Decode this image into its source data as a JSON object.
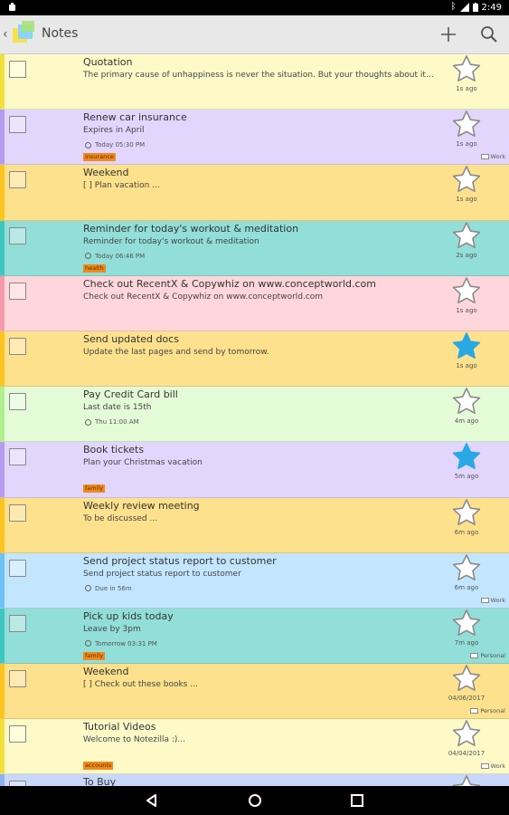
{
  "status_bar": {
    "time": "2:49"
  },
  "app_bar": {
    "title": "Notes"
  },
  "icons": {
    "back": "chevron-left-icon",
    "logo": "sticky-notes-logo-icon",
    "add": "plus-icon",
    "search": "search-icon"
  },
  "colors": {
    "yellow": "#fdfac8",
    "purple": "#e2d6fc",
    "orange": "#fee18c",
    "teal": "#92ded8",
    "pink": "#ffd6dc",
    "green": "#e4fbd8",
    "blue": "#c2e6fe",
    "star_filled": "#29a8e6",
    "tag": "#f08a1c"
  },
  "notes": [
    {
      "title": "Quotation",
      "body": "The primary cause of unhappiness is never the situation. But your thoughts about it…",
      "age": "1s ago",
      "color": "#fdfac8",
      "accent": "#f3df3a",
      "starred": false,
      "reminder": "",
      "tag": "",
      "folder": ""
    },
    {
      "title": "Renew car insurance",
      "body": "Expires in April",
      "age": "1s ago",
      "color": "#e2d6fc",
      "accent": "#b59cf0",
      "starred": false,
      "reminder": "Today 05:30 PM",
      "tag": "insurance",
      "folder": "Work"
    },
    {
      "title": "Weekend",
      "body": "[ ] Plan vacation ...",
      "age": "1s ago",
      "color": "#fee18c",
      "accent": "#fcc41f",
      "starred": false,
      "reminder": "",
      "tag": "",
      "folder": ""
    },
    {
      "title": "Reminder for today's workout & meditation",
      "body": "Reminder for today's workout & meditation",
      "age": "2s ago",
      "color": "#92ded8",
      "accent": "#3ec7c0",
      "starred": false,
      "reminder": "Today 06:46 PM",
      "tag": "health",
      "folder": ""
    },
    {
      "title": "Check out RecentX & Copywhiz  on www.conceptworld.com",
      "body": "Check out RecentX & Copywhiz  on www.conceptworld.com",
      "age": "1s ago",
      "color": "#ffd6dc",
      "accent": "#f59aaa",
      "starred": false,
      "reminder": "",
      "tag": "",
      "folder": ""
    },
    {
      "title": "Send updated docs",
      "body": "Update the last pages and send by tomorrow.",
      "age": "1s ago",
      "color": "#fee18c",
      "accent": "#fcc41f",
      "starred": true,
      "reminder": "",
      "tag": "",
      "folder": ""
    },
    {
      "title": "Pay Credit Card bill",
      "body": "Last date is 15th",
      "age": "4m ago",
      "color": "#e4fbd8",
      "accent": "#aef08e",
      "starred": false,
      "reminder": "Thu 11:00 AM",
      "tag": "",
      "folder": ""
    },
    {
      "title": "Book tickets",
      "body": "Plan your Christmas vacation",
      "age": "5m ago",
      "color": "#e2d6fc",
      "accent": "#b59cf0",
      "starred": true,
      "reminder": "",
      "tag": "family",
      "folder": ""
    },
    {
      "title": "Weekly review meeting",
      "body": "To be discussed ...",
      "age": "6m ago",
      "color": "#fee18c",
      "accent": "#fcc41f",
      "starred": false,
      "reminder": "",
      "tag": "",
      "folder": ""
    },
    {
      "title": "Send project status report to customer",
      "body": "Send project status report to customer",
      "age": "6m ago",
      "color": "#c2e6fe",
      "accent": "#6fc2f6",
      "starred": false,
      "reminder": "Due in 56m",
      "tag": "",
      "folder": "Work"
    },
    {
      "title": "Pick up kids today",
      "body": "Leave by 3pm",
      "age": "7m ago",
      "color": "#92ded8",
      "accent": "#3ec7c0",
      "starred": false,
      "reminder": "Tomorrow 03:31 PM",
      "tag": "family",
      "folder": "Personal"
    },
    {
      "title": "Weekend",
      "body": "[ ] Check out these books ...",
      "age": "04/06/2017",
      "color": "#fee18c",
      "accent": "#fcc41f",
      "starred": false,
      "reminder": "",
      "tag": "",
      "folder": "Personal"
    },
    {
      "title": "Tutorial Videos",
      "body": "Welcome to Notezilla :)...",
      "age": "04/04/2017",
      "color": "#fdfac8",
      "accent": "#f3df3a",
      "starred": false,
      "reminder": "",
      "tag": "accounts",
      "folder": "Work"
    },
    {
      "title": "To Buy",
      "body": "",
      "age": "",
      "color": "#c7d8fc",
      "accent": "#8fb0f5",
      "starred": false,
      "reminder": "",
      "tag": "",
      "folder": ""
    }
  ],
  "nav_bar": {
    "back": "nav-back-icon",
    "home": "nav-home-icon",
    "recents": "nav-recents-icon"
  }
}
